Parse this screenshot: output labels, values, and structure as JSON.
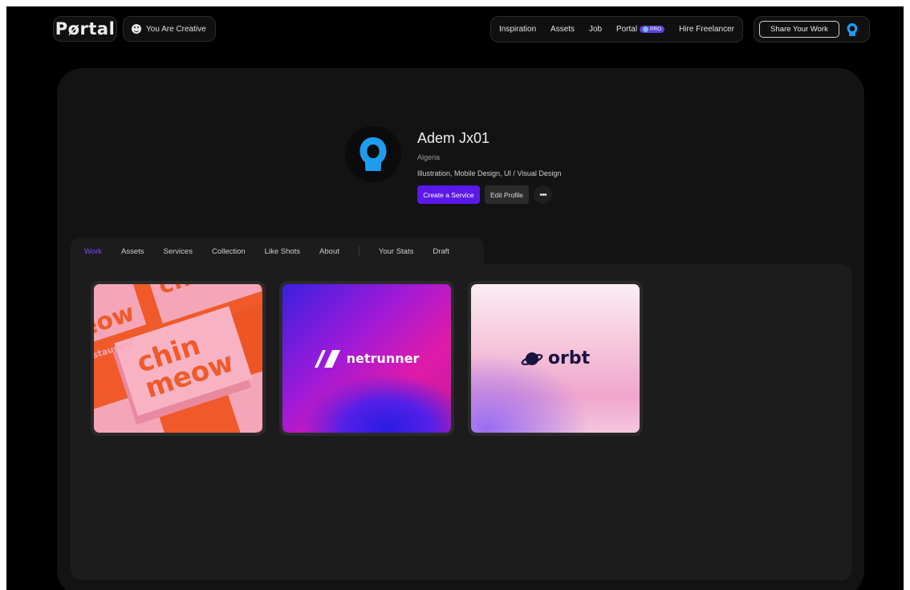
{
  "topbar": {
    "logo": "Pørtal",
    "motto": "You Are Creative",
    "nav": [
      "Inspiration",
      "Assets",
      "Job",
      "Portal",
      "Hire Freelancer"
    ],
    "pro_badge": "PRO",
    "share_label": "Share Your Work"
  },
  "profile": {
    "name": "Adem Jx01",
    "location": "Algeria",
    "skills": "Illustration, Mobile Design, UI / Visual Design",
    "create_service_label": "Create a Service",
    "edit_profile_label": "Edit Profile",
    "more_label": "•••"
  },
  "tabs": {
    "items": [
      "Work",
      "Assets",
      "Services",
      "Collection",
      "Like Shots",
      "About",
      "Your Stats",
      "Draft"
    ],
    "active": "Work"
  },
  "shots": [
    {
      "title": "chin meow",
      "lines": [
        "chin",
        "meow"
      ],
      "subtitle": "asian restaurant"
    },
    {
      "title": "netrunner"
    },
    {
      "title": "orbt"
    }
  ],
  "colors": {
    "accent": "#5a19e8",
    "active_tab": "#7a48f0",
    "avatar_blue": "#1e9cf0",
    "background": "#000000",
    "panel": "#131313"
  },
  "icons": {
    "motto": "smile-icon",
    "avatar": "user-silhouette-icon",
    "more": "more-icon"
  }
}
